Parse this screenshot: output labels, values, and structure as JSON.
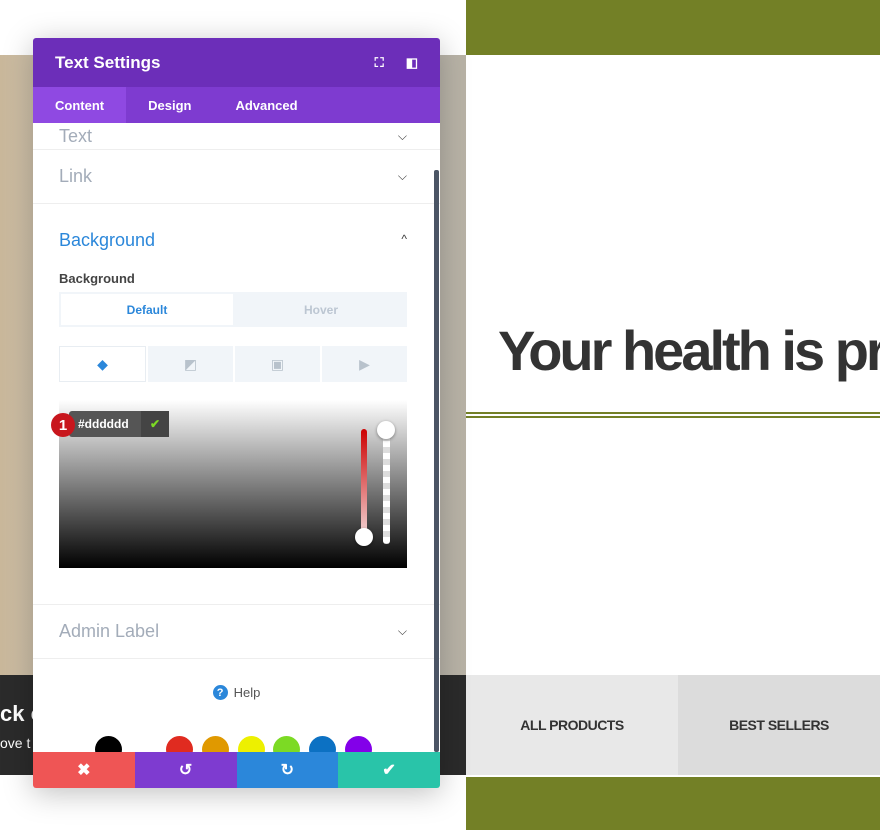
{
  "page": {
    "heading": "Your health is pr",
    "dark_line1": "ck o",
    "dark_line2": "ove t",
    "nav_tabs": [
      "ALL PRODUCTS",
      "BEST SELLERS"
    ]
  },
  "modal": {
    "title": "Text Settings",
    "icons": [
      "fullscreen-icon",
      "sidebar-icon"
    ],
    "tabs": [
      "Content",
      "Design",
      "Advanced"
    ],
    "active_tab": "Content",
    "sections": {
      "text": "Text",
      "link": "Link",
      "background": "Background",
      "admin_label": "Admin Label"
    },
    "background": {
      "label": "Background",
      "states": [
        "Default",
        "Hover"
      ],
      "active_state": "Default",
      "types": [
        "color-icon",
        "gradient-icon",
        "image-icon",
        "video-icon"
      ]
    },
    "picker": {
      "value": "#dddddd",
      "badge": "1",
      "swatches": [
        "#000000",
        "#ffffff",
        "#e02b20",
        "#e09900",
        "#edf000",
        "#7cda24",
        "#0c71c3",
        "#8300e9"
      ]
    },
    "help": "Help",
    "footer": [
      "close",
      "undo",
      "redo",
      "save"
    ]
  },
  "colors": {
    "purple_header": "#6c2eb9",
    "purple_tabs": "#7e3bd0",
    "olive": "#738026",
    "cancel": "#ef5555",
    "undo": "#7e3bd0",
    "redo": "#2b87da",
    "save": "#29c4a9"
  }
}
